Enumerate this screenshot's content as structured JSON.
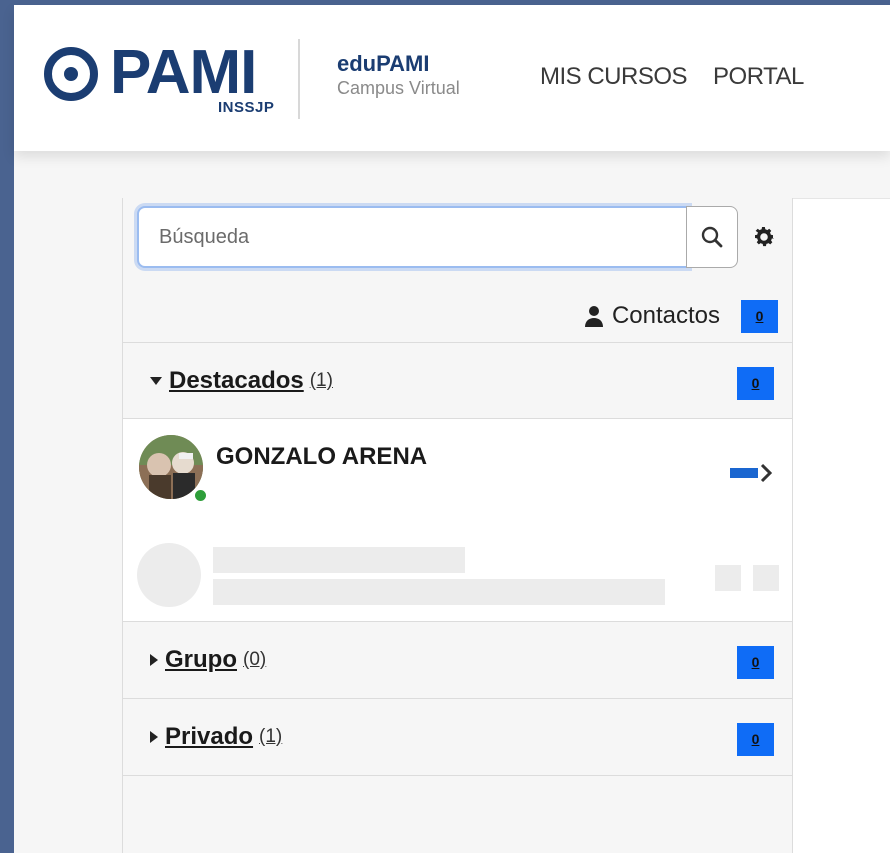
{
  "navbar": {
    "logo_text": "PAMI",
    "logo_sub": "INSSJP",
    "brand_title": "eduPAMI",
    "brand_subtitle": "Campus Virtual",
    "links": [
      "MIS CURSOS",
      "PORTAL"
    ]
  },
  "drawer": {
    "search_placeholder": "Búsqueda",
    "contacts_label": "Contactos",
    "contacts_count": "0",
    "sections": [
      {
        "name": "Destacados",
        "count": "(1)",
        "badge": "0",
        "expanded": true
      },
      {
        "name": "Grupo",
        "count": "(0)",
        "badge": "0",
        "expanded": false
      },
      {
        "name": "Privado",
        "count": "(1)",
        "badge": "0",
        "expanded": false
      }
    ],
    "starred_contact": {
      "name": "GONZALO ARENA",
      "status": "online"
    }
  },
  "colors": {
    "brand": "#1b3d72",
    "badge": "#0f6cf6",
    "frame": "#4a6390",
    "online": "#2e9e3a"
  }
}
